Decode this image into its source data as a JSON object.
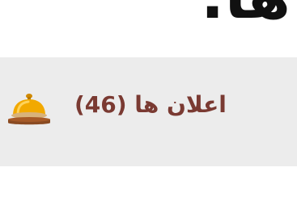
{
  "header": {
    "title_fragment": "ها:"
  },
  "notifications": {
    "label": "اعلان ها (46)",
    "icon": "service-bell-icon",
    "colors": {
      "bar_background": "#ececec",
      "label": "#7a3a32",
      "bell_gold": "#f2a900"
    }
  }
}
